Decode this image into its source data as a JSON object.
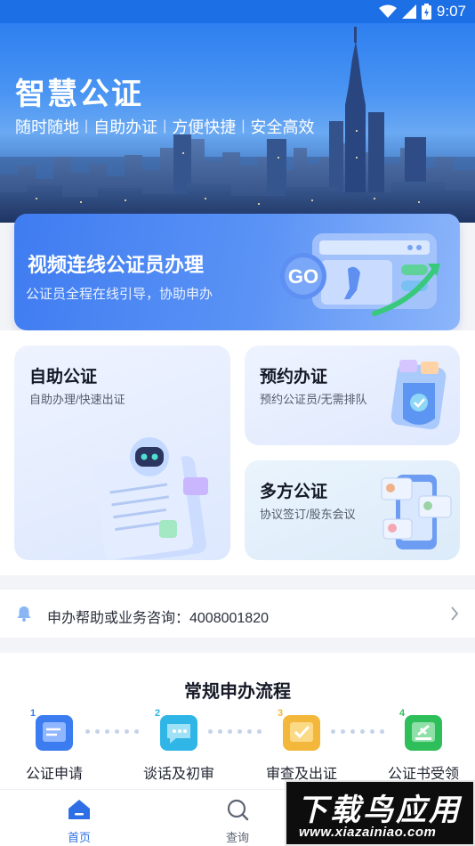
{
  "status_bar": {
    "time": "9:07"
  },
  "hero": {
    "title": "智慧公证",
    "slogans": [
      "随时随地",
      "自助办证",
      "方便快捷",
      "安全高效"
    ],
    "separator": "|"
  },
  "video_card": {
    "title": "视频连线公证员办理",
    "subtitle": "公证员全程在线引导，协助申办",
    "badge": "GO"
  },
  "services": {
    "self": {
      "title": "自助公证",
      "subtitle": "自助办理/快速出证"
    },
    "appointment": {
      "title": "预约办证",
      "subtitle": "预约公证员/无需排队"
    },
    "multi_party": {
      "title": "多方公证",
      "subtitle": "协议签订/股东会议"
    }
  },
  "hotline": {
    "label": "申办帮助或业务咨询：4008001820"
  },
  "process": {
    "title": "常规申办流程",
    "steps": [
      {
        "num": "1",
        "label": "公证申请",
        "color": "#3b7cf0"
      },
      {
        "num": "2",
        "label": "谈话及初审",
        "color": "#2fb5e6"
      },
      {
        "num": "3",
        "label": "审查及出证",
        "color": "#f3b73c"
      },
      {
        "num": "4",
        "label": "公证书受领",
        "color": "#2fbf5a"
      }
    ]
  },
  "tabbar": {
    "home": "首页",
    "query": "查询"
  },
  "watermark": {
    "text": "下载鸟应用",
    "url": "www.xiazainiao.com"
  },
  "colors": {
    "primary": "#2f6fe6",
    "hero_top": "#1d6fe6"
  }
}
